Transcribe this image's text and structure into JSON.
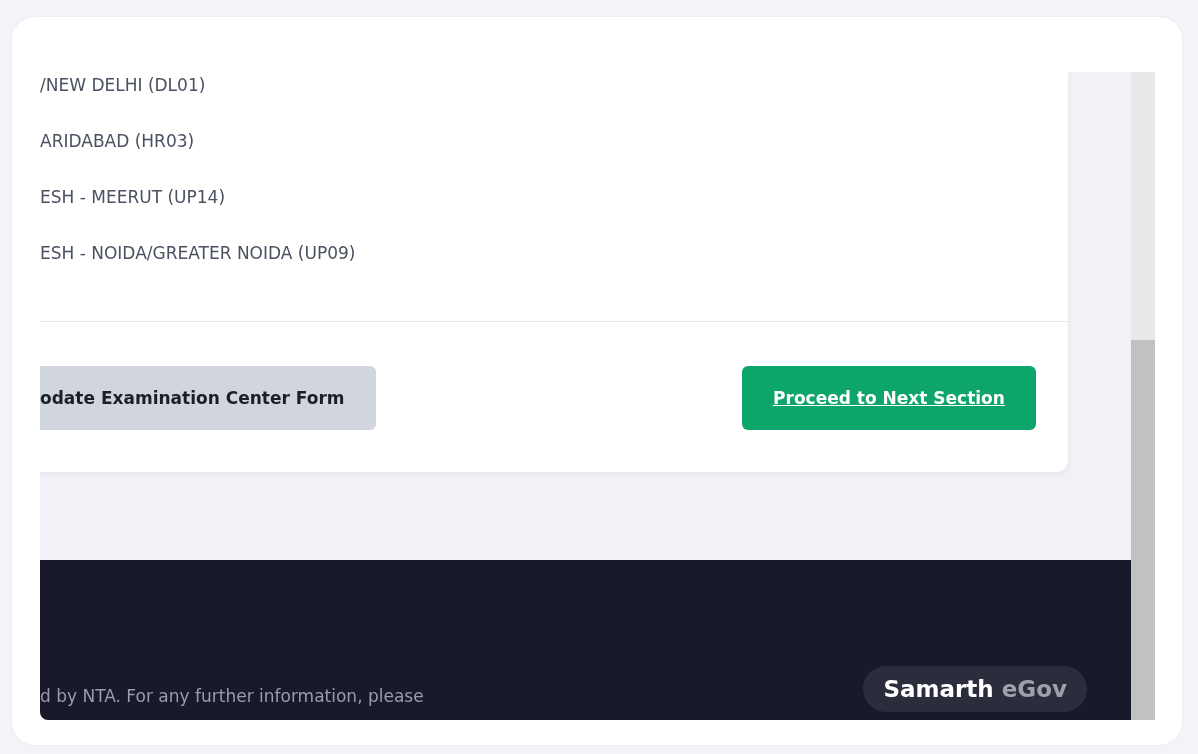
{
  "centers": [
    "/NEW DELHI (DL01)",
    "ARIDABAD (HR03)",
    "ESH - MEERUT (UP14)",
    "ESH - NOIDA/GREATER NOIDA (UP09)"
  ],
  "buttons": [
    {
      "kind": "secondary",
      "label": "odate Examination Center Form"
    },
    {
      "kind": "primary",
      "label": "Proceed to Next Section"
    }
  ],
  "footer": {
    "text": "d by NTA. For any further information, please",
    "brand": [
      "Samarth",
      "eGov"
    ]
  }
}
